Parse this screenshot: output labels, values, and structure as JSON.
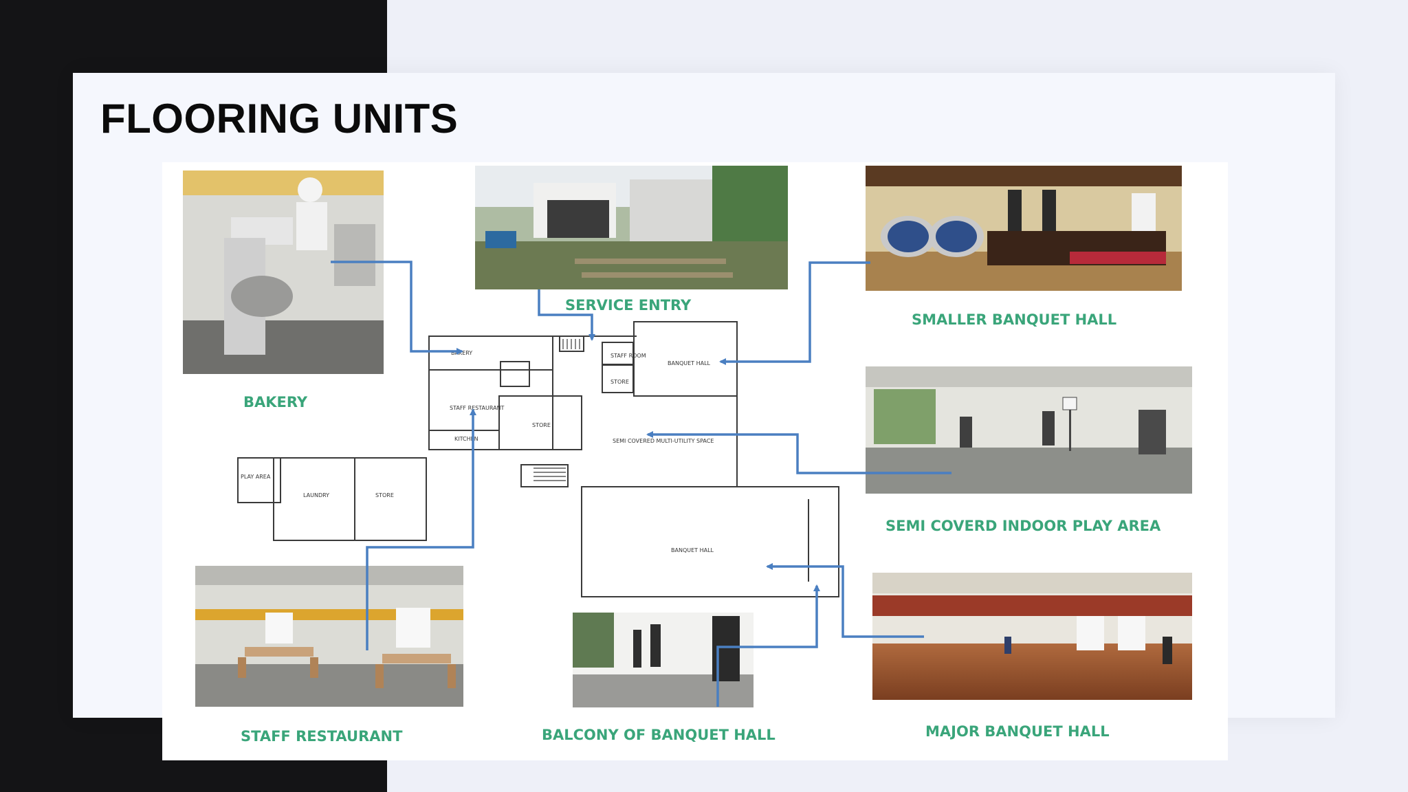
{
  "slide": {
    "title": "FLOORING UNITS"
  },
  "photos": {
    "bakery": "BAKERY",
    "service_entry": "SERVICE ENTRY",
    "smaller_banquet": "SMALLER  BANQUET HALL",
    "semi_covered": "SEMI COVERD INDOOR PLAY AREA",
    "staff_restaurant": "STAFF RESTAURANT",
    "balcony": "BALCONY OF BANQUET HALL",
    "major_banquet": "MAJOR BANQUET HALL"
  },
  "plan": {
    "bakery": "BAKERY",
    "staff_room": "STAFF ROOM",
    "store": "STORE",
    "banquet_hall": "BANQUET HALL",
    "staff_restaurant": "STAFF RESTAURANT",
    "kitchen": "KITCHEN",
    "semi_covered": "SEMI COVERED MULTI-UTILITY SPACE",
    "play_area": "PLAY AREA",
    "laundry": "LAUNDRY",
    "banquet_hall_main": "BANQUET HALL"
  },
  "colors": {
    "label_green": "#3aa57a",
    "arrow_blue": "#4a7fc1"
  }
}
